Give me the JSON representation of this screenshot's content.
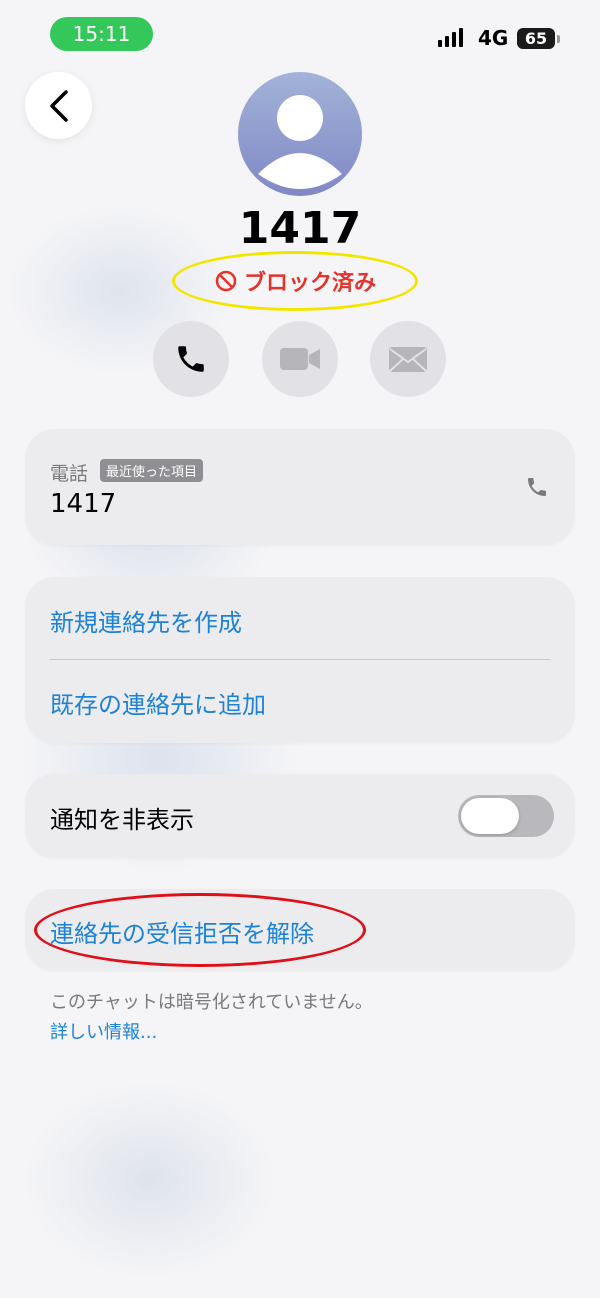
{
  "status_bar": {
    "time": "15:11",
    "network": "4G",
    "battery": "65"
  },
  "contact": {
    "name": "1417",
    "blocked_label": "ブロック済み"
  },
  "phone_card": {
    "label": "電話",
    "badge": "最近使った項目",
    "number": "1417"
  },
  "contact_actions": {
    "create_new": "新規連絡先を作成",
    "add_existing": "既存の連絡先に追加"
  },
  "notifications": {
    "label": "通知を非表示",
    "toggle_on": false
  },
  "unblock": {
    "label": "連絡先の受信拒否を解除"
  },
  "encryption": {
    "note": "このチャットは暗号化されていません。",
    "more_link": "詳しい情報..."
  },
  "colors": {
    "time_pill": "#34c759",
    "link": "#1d82d8",
    "blocked": "#e5322b",
    "highlight_yellow": "#f2e600",
    "highlight_red": "#e0101a"
  },
  "icons": {
    "back": "chevron-left-icon",
    "call": "phone-icon",
    "video": "video-camera-icon",
    "mail": "envelope-icon",
    "blocked": "prohibited-icon"
  }
}
